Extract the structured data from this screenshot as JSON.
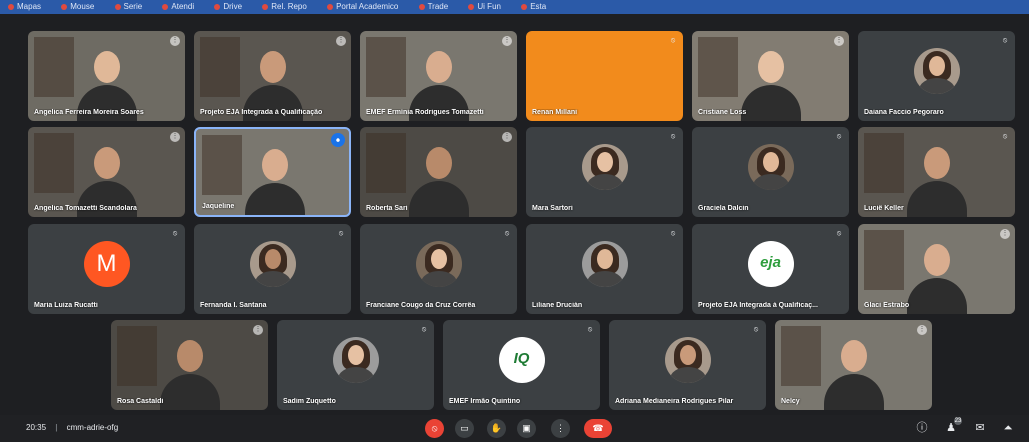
{
  "colors": {
    "background": "#1e1f22",
    "tile": "#3c4043",
    "accent_orange": "#f28b1c",
    "hangup": "#ea4335",
    "speaking": "#1a73e8"
  },
  "bookmarks_bar": {
    "items": [
      "Mapas",
      "Mouse",
      "Serie",
      "Atendi",
      "Drive",
      "Rel. Repo",
      "Portal Academico",
      "Trade",
      "Ui Fun",
      "Esta"
    ]
  },
  "participants": [
    {
      "name": "Angelica Ferreira Moreira Soares",
      "tile": "video",
      "indicator": "options-icon"
    },
    {
      "name": "Projeto EJA Integrada à Qualificação",
      "tile": "video",
      "indicator": "options-icon"
    },
    {
      "name": "EMEF Ermínia Rodrigues Tomazetti",
      "tile": "video",
      "indicator": "options-icon"
    },
    {
      "name": "Renan Millani",
      "tile": "orange",
      "indicator": "mic-off-icon"
    },
    {
      "name": "Cristiane Loss",
      "tile": "video",
      "indicator": "options-icon"
    },
    {
      "name": "Daiana Faccio Pegoraro",
      "tile": "avatar",
      "indicator": "mic-off-icon"
    },
    {
      "name": "Angelica Tomazetti Scandolara",
      "tile": "video",
      "indicator": "options-icon"
    },
    {
      "name": "Jaqueline",
      "tile": "video",
      "indicator": "speaking-icon"
    },
    {
      "name": "Roberta Sari",
      "tile": "video",
      "indicator": "options-icon"
    },
    {
      "name": "Mara Sartori",
      "tile": "avatar",
      "indicator": "mic-off-icon"
    },
    {
      "name": "Graciela Dalcin",
      "tile": "avatar",
      "indicator": "mic-off-icon"
    },
    {
      "name": "Luciê Keller",
      "tile": "video",
      "indicator": "mic-off-icon"
    },
    {
      "name": "Maria Luiza Rucatti",
      "tile": "letter",
      "letter": "M",
      "indicator": "mic-off-icon"
    },
    {
      "name": "Fernanda I. Santana",
      "tile": "avatar",
      "indicator": "mic-off-icon"
    },
    {
      "name": "Franciane Cougo da Cruz Corrêa",
      "tile": "avatar",
      "indicator": "mic-off-icon"
    },
    {
      "name": "Liliane Drucián",
      "tile": "avatar",
      "indicator": "mic-off-icon"
    },
    {
      "name": "Projeto EJA Integrada à Qualificaç...",
      "tile": "logo",
      "logo_text": "eja",
      "indicator": "mic-off-icon"
    },
    {
      "name": "Glaci Estrabo",
      "tile": "video",
      "indicator": "options-icon"
    },
    {
      "name": "Rosa Castaldi",
      "tile": "video",
      "indicator": "options-icon"
    },
    {
      "name": "Sadim Zuquetto",
      "tile": "avatar",
      "indicator": "mic-off-icon"
    },
    {
      "name": "EMEF Irmão Quintino",
      "tile": "logo",
      "logo_text": "IQ",
      "indicator": "mic-off-icon"
    },
    {
      "name": "Adriana Medianeira Rodrigues Pilar",
      "tile": "avatar",
      "indicator": "mic-off-icon"
    },
    {
      "name": "Nelcy",
      "tile": "video",
      "indicator": "options-icon"
    }
  ],
  "toolbar": {
    "time": "20:35",
    "separator": "|",
    "meeting_code": "cmm-adrie-ofg",
    "controls": [
      {
        "name": "mic-off-button",
        "glyph": "⦸"
      },
      {
        "name": "camera-button",
        "glyph": "▭"
      },
      {
        "name": "raise-hand-button",
        "glyph": "✋"
      },
      {
        "name": "present-button",
        "glyph": "▣"
      },
      {
        "name": "more-options-button",
        "glyph": "⋮"
      },
      {
        "name": "leave-call-button",
        "glyph": "☎"
      }
    ],
    "right": [
      {
        "name": "meeting-details-button",
        "glyph": "ⓘ"
      },
      {
        "name": "people-button",
        "glyph": "♟",
        "badge": "23"
      },
      {
        "name": "chat-button",
        "glyph": "✉"
      },
      {
        "name": "activities-button",
        "glyph": "⏶"
      }
    ]
  }
}
